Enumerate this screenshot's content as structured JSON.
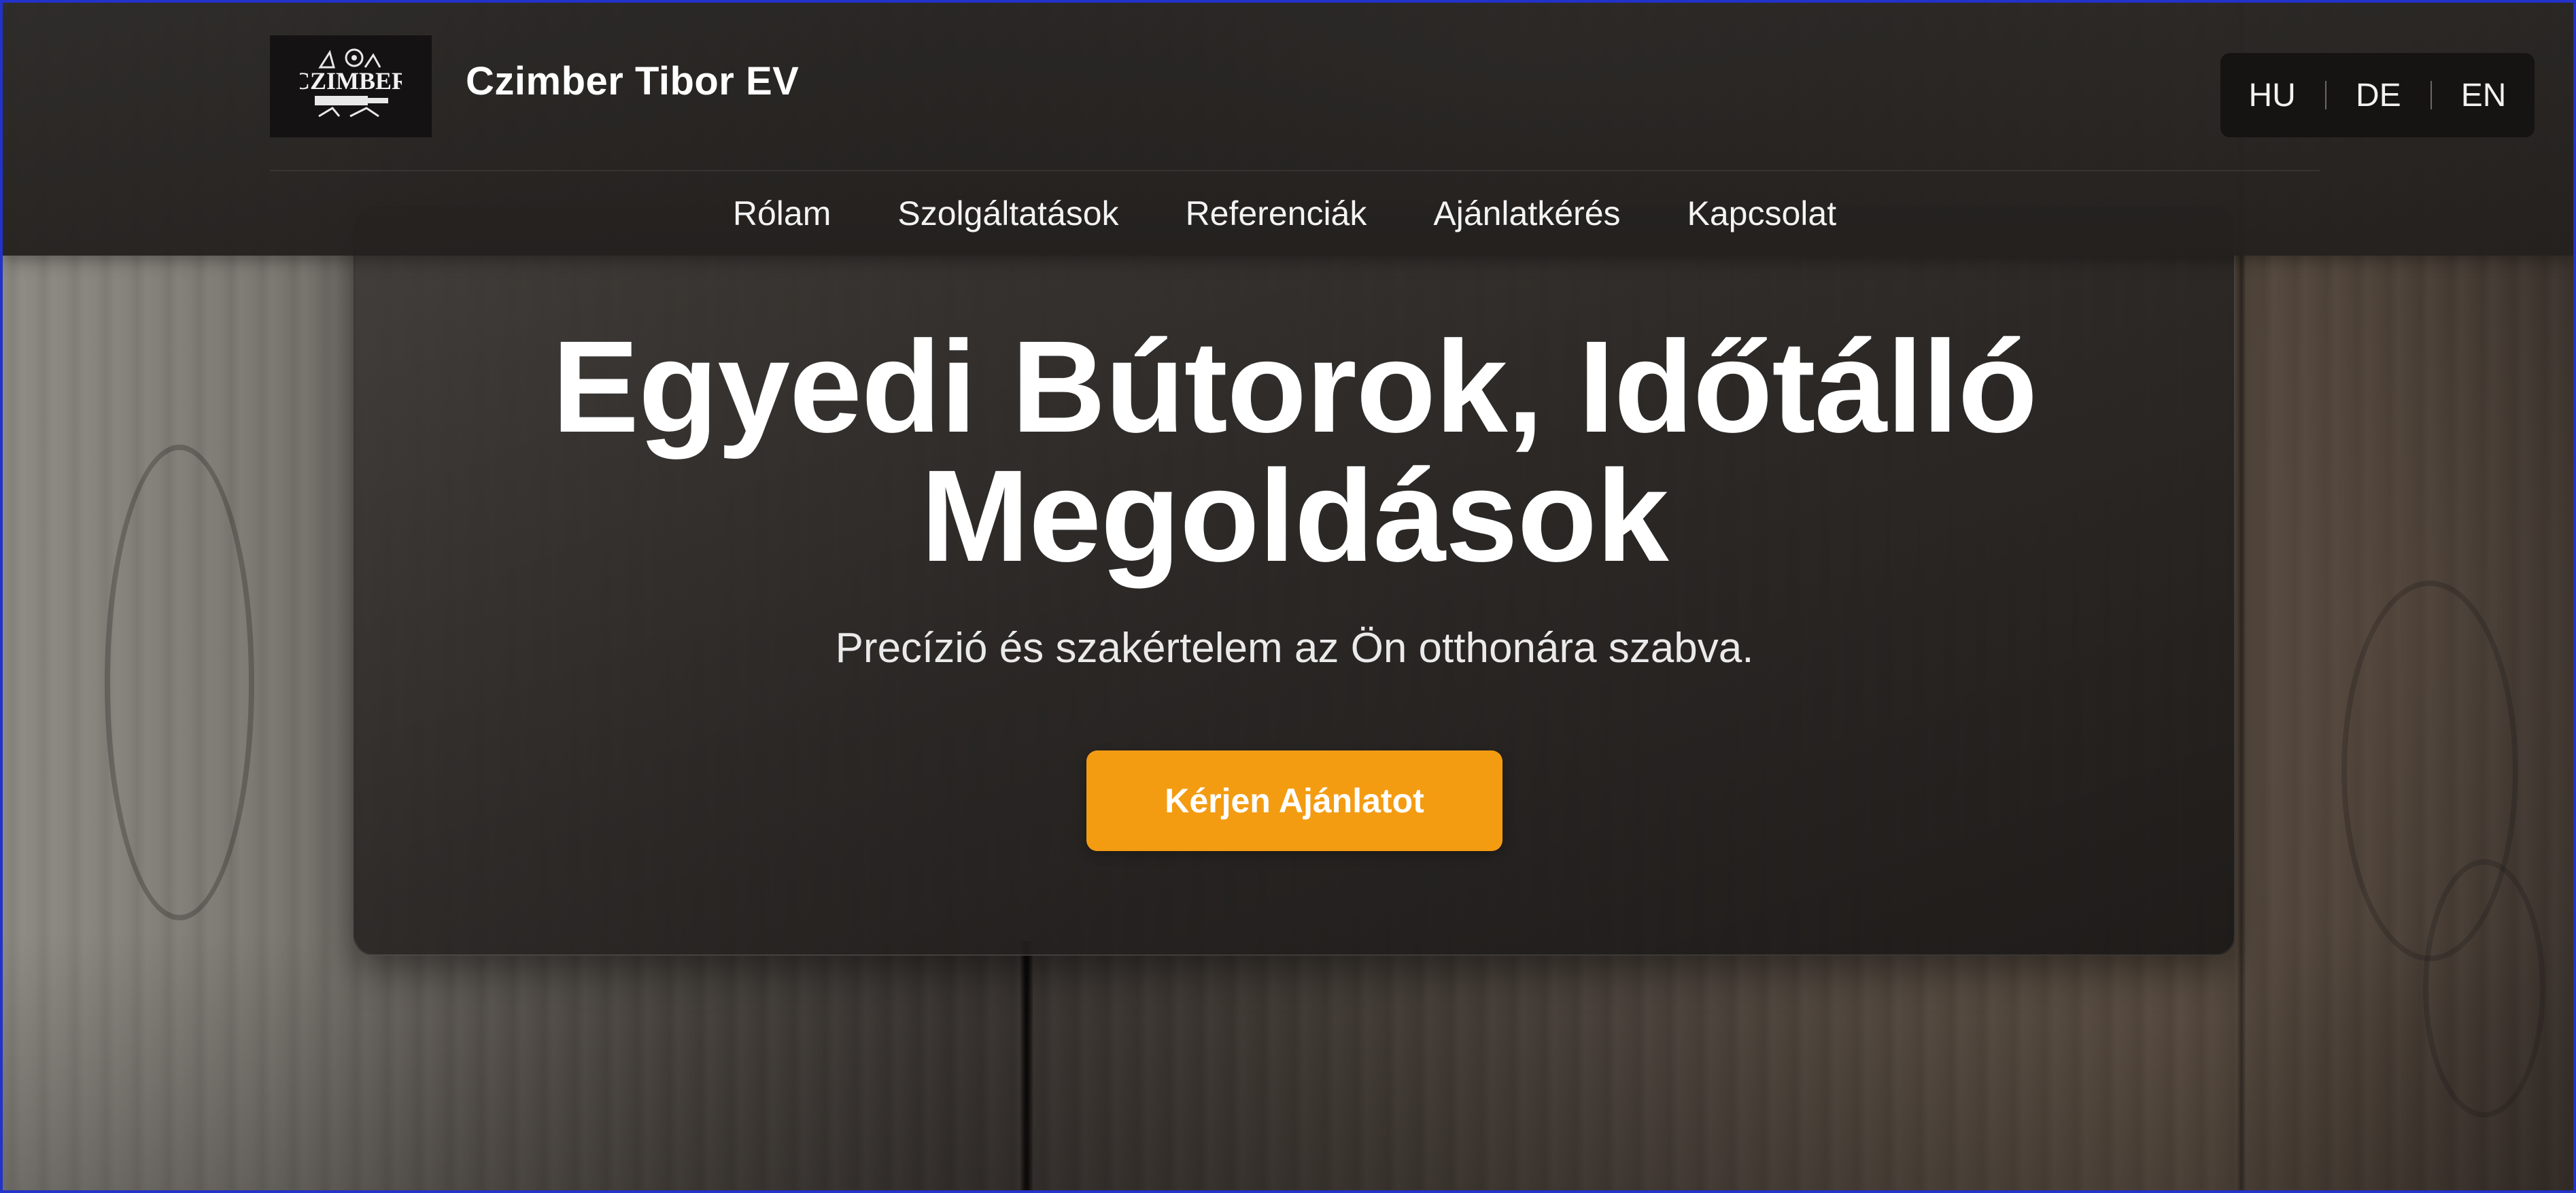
{
  "header": {
    "logo_text": "CZIMBER",
    "brand_name": "Czimber Tibor EV",
    "languages": [
      "HU",
      "DE",
      "EN"
    ],
    "nav": [
      "Rólam",
      "Szolgáltatások",
      "Referenciák",
      "Ajánlatkérés",
      "Kapcsolat"
    ]
  },
  "hero": {
    "title_line1": "Egyedi Bútorok, Időtálló",
    "title_line2": "Megoldások",
    "subtitle": "Precízió és szakértelem az Ön otthonára szabva.",
    "cta_label": "Kérjen Ajánlatot"
  },
  "colors": {
    "accent": "#f39c12",
    "header_bg": "#282624",
    "card_bg": "#2a2725",
    "text": "#ffffff"
  },
  "icons": {
    "logo": "carpentry-logo-icon"
  }
}
